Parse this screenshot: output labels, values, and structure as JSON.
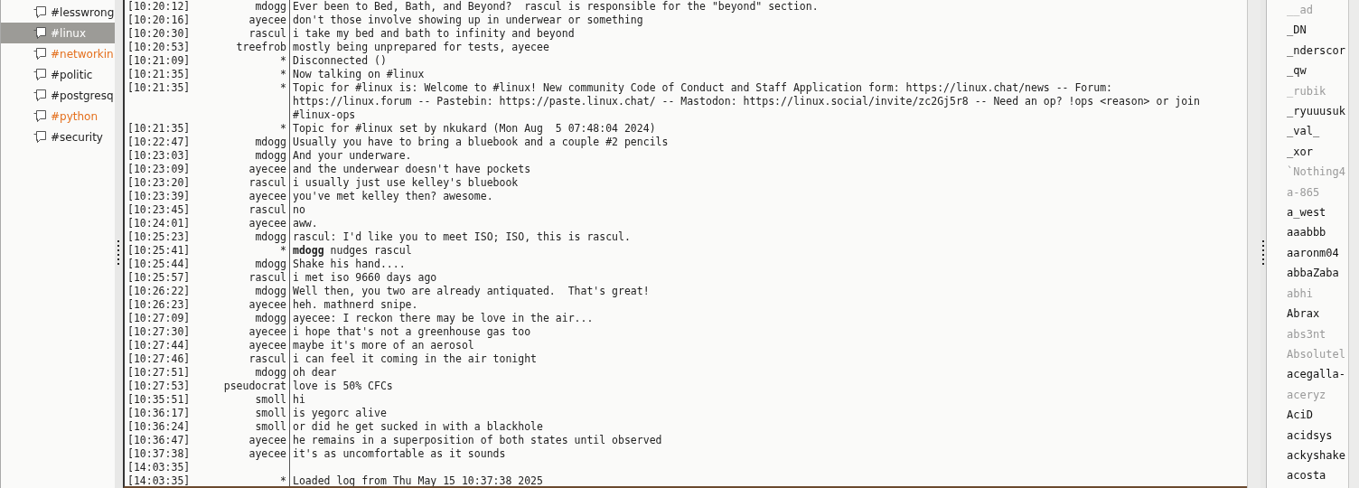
{
  "channels": [
    {
      "name": "#lesswrong",
      "selected": false,
      "activity": false
    },
    {
      "name": "#linux",
      "selected": true,
      "activity": false
    },
    {
      "name": "#networkin",
      "selected": false,
      "activity": true
    },
    {
      "name": "#politic",
      "selected": false,
      "activity": false
    },
    {
      "name": "#postgresq",
      "selected": false,
      "activity": false
    },
    {
      "name": "#python",
      "selected": false,
      "activity": true
    },
    {
      "name": "#security",
      "selected": false,
      "activity": false
    }
  ],
  "messages": [
    {
      "time": "[10:20:12]",
      "nick": "mdogg",
      "text": "Ever been to Bed, Bath, and Beyond?  rascul is responsible for the \"beyond\" section."
    },
    {
      "time": "[10:20:16]",
      "nick": "ayecee",
      "text": "don't those involve showing up in underwear or something"
    },
    {
      "time": "[10:20:30]",
      "nick": "rascul",
      "text": "i take my bed and bath to infinity and beyond"
    },
    {
      "time": "[10:20:53]",
      "nick": "treefrob",
      "text": "mostly being unprepared for tests, ayecee"
    },
    {
      "time": "[10:21:09]",
      "nick": "*",
      "text": "Disconnected ()"
    },
    {
      "time": "[10:21:35]",
      "nick": "*",
      "text": "Now talking on #linux"
    },
    {
      "time": "[10:21:35]",
      "nick": "*",
      "text": "Topic for #linux is: Welcome to #linux! New community Code of Conduct and Staff Application form: https://linux.chat/news -- Forum: https://linux.forum -- Pastebin: https://paste.linux.chat/ -- Mastodon: https://linux.social/invite/zc2Gj5r8 -- Need an op? !ops <reason> or join #linux-ops"
    },
    {
      "time": "[10:21:35]",
      "nick": "*",
      "text": "Topic for #linux set by nkukard (Mon Aug  5 07:48:04 2024)"
    },
    {
      "time": "[10:22:47]",
      "nick": "mdogg",
      "text": "Usually you have to bring a bluebook and a couple #2 pencils"
    },
    {
      "time": "[10:23:03]",
      "nick": "mdogg",
      "text": "And your underware."
    },
    {
      "time": "[10:23:09]",
      "nick": "ayecee",
      "text": "and the underwear doesn't have pockets"
    },
    {
      "time": "[10:23:20]",
      "nick": "rascul",
      "text": "i usually just use kelley's bluebook"
    },
    {
      "time": "[10:23:39]",
      "nick": "ayecee",
      "text": "you've met kelley then? awesome."
    },
    {
      "time": "[10:23:45]",
      "nick": "rascul",
      "text": "no"
    },
    {
      "time": "[10:24:01]",
      "nick": "ayecee",
      "text": "aww."
    },
    {
      "time": "[10:25:23]",
      "nick": "mdogg",
      "text": "rascul: I'd like you to meet ISO; ISO, this is rascul."
    },
    {
      "time": "[10:25:41]",
      "nick": "*",
      "text": "**mdogg** nudges rascul"
    },
    {
      "time": "[10:25:44]",
      "nick": "mdogg",
      "text": "Shake his hand...."
    },
    {
      "time": "[10:25:57]",
      "nick": "rascul",
      "text": "i met iso 9660 days ago"
    },
    {
      "time": "[10:26:22]",
      "nick": "mdogg",
      "text": "Well then, you two are already antiquated.  That's great!"
    },
    {
      "time": "[10:26:23]",
      "nick": "ayecee",
      "text": "heh. mathnerd snipe."
    },
    {
      "time": "[10:27:09]",
      "nick": "mdogg",
      "text": "ayecee: I reckon there may be love in the air..."
    },
    {
      "time": "[10:27:30]",
      "nick": "ayecee",
      "text": "i hope that's not a greenhouse gas too"
    },
    {
      "time": "[10:27:44]",
      "nick": "ayecee",
      "text": "maybe it's more of an aerosol"
    },
    {
      "time": "[10:27:46]",
      "nick": "rascul",
      "text": "i can feel it coming in the air tonight"
    },
    {
      "time": "[10:27:51]",
      "nick": "mdogg",
      "text": "oh dear"
    },
    {
      "time": "[10:27:53]",
      "nick": "pseudocrat",
      "text": "love is 50% CFCs"
    },
    {
      "time": "[10:35:51]",
      "nick": "smoll",
      "text": "hi"
    },
    {
      "time": "[10:36:17]",
      "nick": "smoll",
      "text": "is yegorc alive"
    },
    {
      "time": "[10:36:24]",
      "nick": "smoll",
      "text": "or did he get sucked in with a blackhole"
    },
    {
      "time": "[10:36:47]",
      "nick": "ayecee",
      "text": "he remains in a superposition of both states until observed"
    },
    {
      "time": "[10:37:38]",
      "nick": "ayecee",
      "text": "it's as uncomfortable as it sounds"
    },
    {
      "time": "[14:03:35]"
    },
    {
      "time": "[14:03:35]",
      "nick": "*",
      "text": "Loaded log from Thu May 15 10:37:38 2025"
    }
  ],
  "users": [
    {
      "nick": "__ad",
      "away": true
    },
    {
      "nick": "_DN",
      "away": false
    },
    {
      "nick": "_nderscor",
      "away": false
    },
    {
      "nick": "_qw",
      "away": false
    },
    {
      "nick": "_rubik",
      "away": true
    },
    {
      "nick": "_ryuuusuk",
      "away": false
    },
    {
      "nick": "_val_",
      "away": false
    },
    {
      "nick": "_xor",
      "away": false
    },
    {
      "nick": "`Nothing4",
      "away": true
    },
    {
      "nick": "a-865",
      "away": true
    },
    {
      "nick": "a_west",
      "away": false
    },
    {
      "nick": "aaabbb",
      "away": false
    },
    {
      "nick": "aaronm04",
      "away": false
    },
    {
      "nick": "abbaZaba",
      "away": false
    },
    {
      "nick": "abhi",
      "away": true
    },
    {
      "nick": "Abrax",
      "away": false
    },
    {
      "nick": "abs3nt",
      "away": true
    },
    {
      "nick": "Absolutel",
      "away": true
    },
    {
      "nick": "acegalla-",
      "away": false
    },
    {
      "nick": "aceryz",
      "away": true
    },
    {
      "nick": "AciD",
      "away": false
    },
    {
      "nick": "acidsys",
      "away": false
    },
    {
      "nick": "ackyshake",
      "away": false
    },
    {
      "nick": "acosta",
      "away": false
    }
  ]
}
